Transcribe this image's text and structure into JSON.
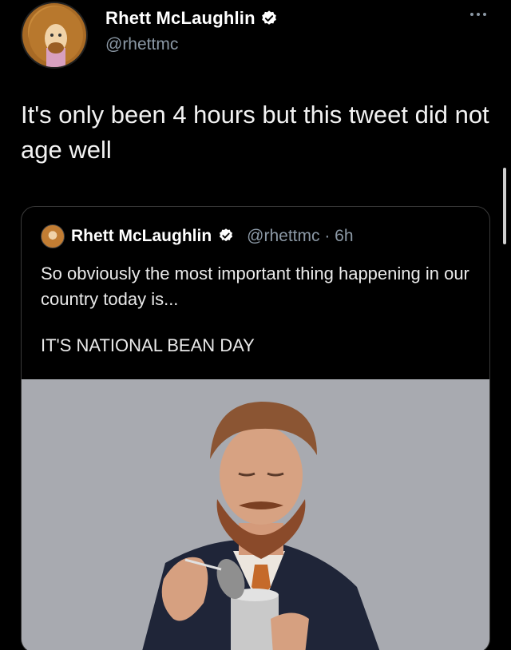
{
  "tweet": {
    "author_name": "Rhett McLaughlin",
    "author_handle": "@rhettmc",
    "text": "It's only been 4 hours but this tweet did not age well",
    "more_icon": "more-horizontal-icon"
  },
  "quoted": {
    "author_name": "Rhett McLaughlin",
    "meta": "@rhettmc · 6h",
    "text_line1": "So obviously the most important thing happening in our country today is...",
    "text_line2": "IT'S NATIONAL BEAN DAY"
  },
  "colors": {
    "background": "#000000",
    "verified": "#ffffff",
    "muted_text": "#8b98a5"
  }
}
